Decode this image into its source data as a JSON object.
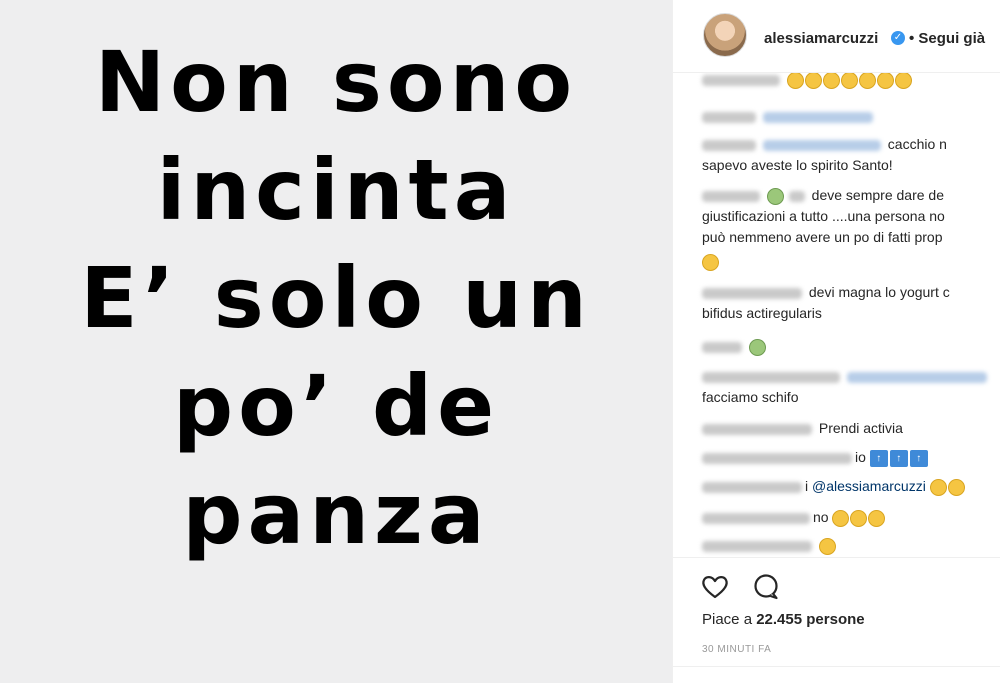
{
  "image": {
    "lines": [
      "Non sono",
      "incinta",
      "E’ solo un",
      "po’ de",
      "panza"
    ],
    "background": "#eeeeef"
  },
  "header": {
    "username": "alessiamarcuzzi",
    "follow_label": "• Segui già"
  },
  "comments": [
    {
      "text": ""
    },
    {
      "text": ""
    },
    {
      "text": "cacchio n"
    },
    {
      "text": "sapevo aveste lo spirito Santo!"
    },
    {
      "text": "deve sempre dare de"
    },
    {
      "text": "giustificazioni a tutto ....una persona no"
    },
    {
      "text": "può nemmeno avere un po di fatti prop"
    },
    {
      "text": "devi magna lo yogurt c"
    },
    {
      "text": "bifidus actiregularis"
    },
    {
      "text": ""
    },
    {
      "text": "facciamo schifo"
    },
    {
      "text": "Prendi activia"
    },
    {
      "text": "io"
    },
    {
      "text": "i"
    },
    {
      "text": "@alessiamarcuzzi"
    },
    {
      "text": "no"
    }
  ],
  "actions": {
    "likes_prefix": "Piace a ",
    "likes_count": "22.455",
    "likes_suffix": " persone",
    "time_ago": "30 MINUTI FA"
  },
  "colors": {
    "accent": "#3897f0",
    "mention": "#003569"
  }
}
